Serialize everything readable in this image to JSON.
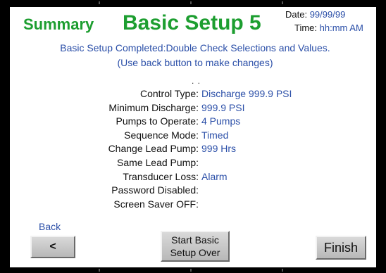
{
  "header": {
    "summary": "Summary",
    "title": "Basic Setup 5",
    "date_label": "Date:",
    "date_value": "99/99/99",
    "time_label": "Time:",
    "time_value": "hh:mm AM"
  },
  "message": {
    "line1": "Basic Setup Completed:Double Check Selections and Values.",
    "line2": "(Use back button to make changes)",
    "dots": ". ."
  },
  "settings": [
    {
      "label": "Control Type:",
      "value": "Discharge 999.9 PSI"
    },
    {
      "label": "Minimum Discharge:",
      "value": "999.9 PSI"
    },
    {
      "label": "Pumps to Operate:",
      "value": "4 Pumps"
    },
    {
      "label": "Sequence Mode:",
      "value": "Timed"
    },
    {
      "label": "Change Lead Pump:",
      "value": "999 Hrs"
    },
    {
      "label": "Same Lead Pump:",
      "value": ""
    },
    {
      "label": "Transducer Loss:",
      "value": "Alarm"
    },
    {
      "label": "Password Disabled:",
      "value": ""
    },
    {
      "label": "Screen Saver OFF:",
      "value": ""
    }
  ],
  "buttons": {
    "back_label": "Back",
    "back_glyph": "<",
    "start_over_line1": "Start Basic",
    "start_over_line2": "Setup Over",
    "finish": "Finish"
  },
  "colors": {
    "title_green": "#1d9e30",
    "value_blue": "#2b4fa8",
    "bezel": "#000000"
  }
}
